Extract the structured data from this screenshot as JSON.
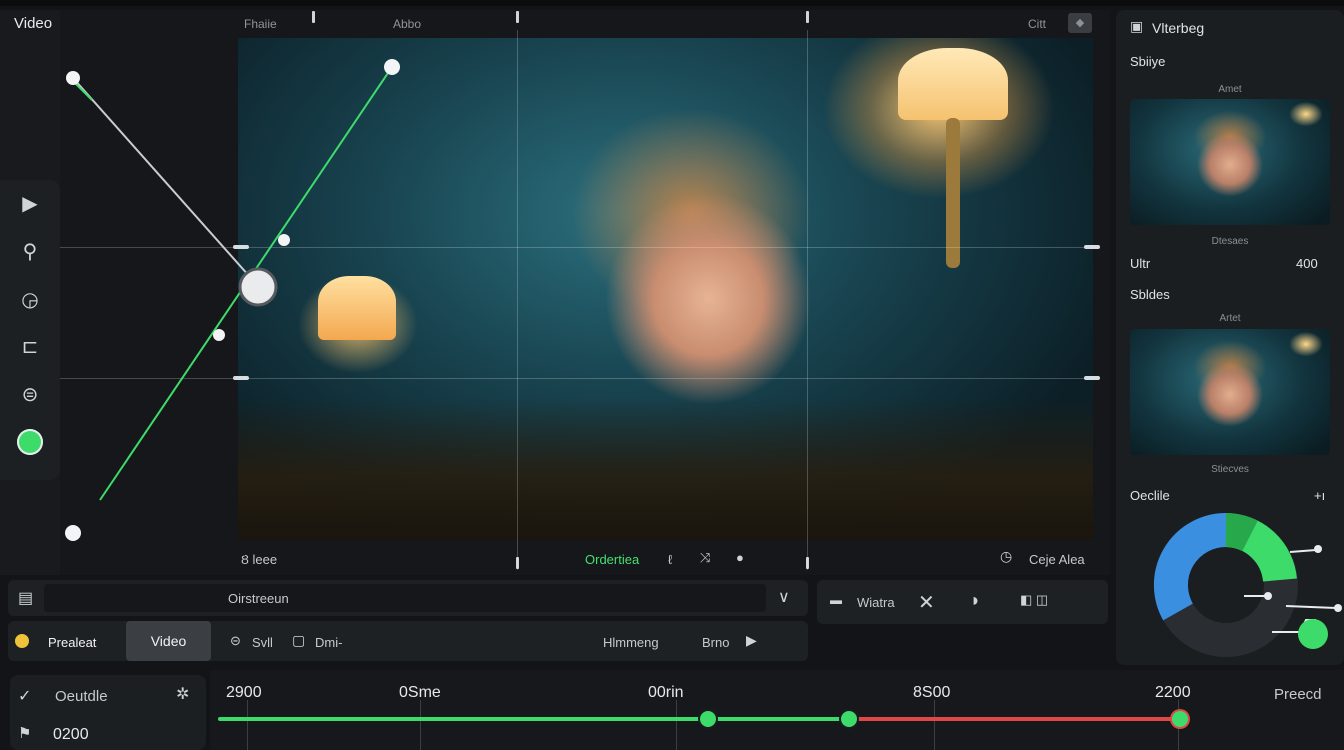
{
  "app": {
    "title": "Video"
  },
  "ruler": {
    "left_label": "Fhaiie",
    "center_label": "Abbo",
    "right_label": "Citt"
  },
  "left_tools": [
    {
      "icon": "play-icon"
    },
    {
      "icon": "search-icon"
    },
    {
      "icon": "timer-icon"
    },
    {
      "icon": "crop-icon"
    },
    {
      "icon": "sync-icon"
    },
    {
      "icon": "color-dot-icon"
    }
  ],
  "preview": {
    "status_left": "Ȣ leee",
    "status_center": "Ordertiea",
    "status_center_extra": "ℓ",
    "status_right": "Ceje Alea"
  },
  "right_panel": {
    "title": "Vlterbeg",
    "section1_label": "Sbiiye",
    "thumb1_caption_top": "Amet",
    "thumb1_caption_bottom": "Dtesaes",
    "metric_label": "Ultr",
    "metric_value": "400",
    "section2_label": "Sbldes",
    "thumb2_caption_top": "Artet",
    "thumb2_caption_bottom": "Stiecves",
    "color_label": "Oeclile",
    "color_label_icon": "+ı",
    "colors": {
      "blue": "#3a8fe0",
      "green": "#3ddc6a",
      "dark": "#2a2d31"
    }
  },
  "search_bar": {
    "value": "Oirstreeun"
  },
  "effect_bar": {
    "label": "Wiatra"
  },
  "mode_bar": {
    "project_label": "Prealeat",
    "active_tab": "Video",
    "tab2": "Svll",
    "tab3": "Dmi-",
    "status": "Hlmmeng",
    "play_label": "Brno"
  },
  "track": {
    "label1": "Oeutdle",
    "label2": "0200"
  },
  "timeline": {
    "markers": [
      "2900",
      "0Sme",
      "00rin",
      "8S00",
      "2200"
    ],
    "end_label": "Preecd",
    "progress": {
      "green_end_fraction": 0.61,
      "red_end_fraction": 0.92
    }
  },
  "colors": {
    "accent_green": "#3ddc6a",
    "accent_red": "#e04848"
  }
}
